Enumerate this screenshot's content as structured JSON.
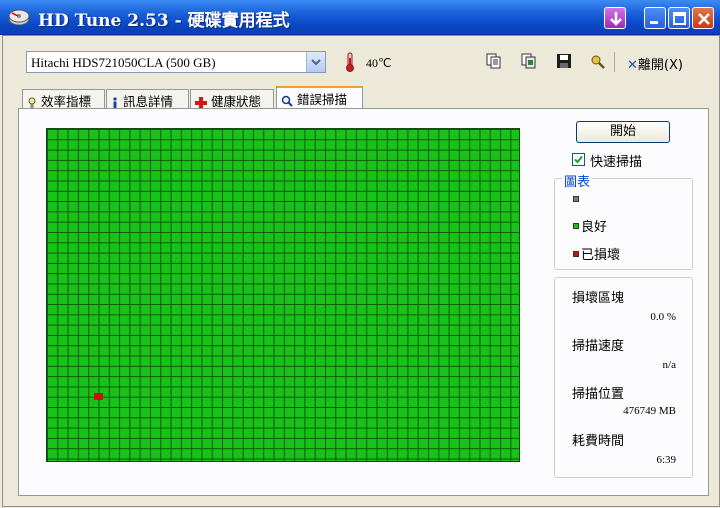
{
  "window": {
    "title": "HD Tune 2.53 - 硬碟實用程式"
  },
  "toolbar": {
    "drive": "Hitachi HDS721050CLA (500 GB)",
    "temperature": "40℃",
    "icons": [
      "copy-text-icon",
      "copy-screenshot-icon",
      "save-icon",
      "options-icon"
    ],
    "exit_label": "離開(X)"
  },
  "tabs": [
    {
      "label": "效率指標",
      "icon": "benchmark-icon"
    },
    {
      "label": "訊息詳情",
      "icon": "info-icon"
    },
    {
      "label": "健康狀態",
      "icon": "health-icon"
    },
    {
      "label": "錯誤掃描",
      "icon": "error-scan-icon",
      "active": true
    }
  ],
  "scan": {
    "start_label": "開始",
    "quick_scan_label": "快速掃描",
    "quick_scan_checked": true,
    "legend_title": "圖表",
    "legend": [
      {
        "label": "",
        "color": "#808080"
      },
      {
        "label": "良好",
        "color": "#19c219"
      },
      {
        "label": "已損壞",
        "color": "#cc1111"
      }
    ],
    "grid_colors": {
      "good": "#19c219",
      "damaged": "#cc1111"
    },
    "stats": [
      {
        "label": "損壞區塊",
        "value": "0.0 %"
      },
      {
        "label": "掃描速度",
        "value": "n/a"
      },
      {
        "label": "掃描位置",
        "value": "476749 MB"
      },
      {
        "label": "耗費時間",
        "value": "6:39"
      }
    ]
  }
}
